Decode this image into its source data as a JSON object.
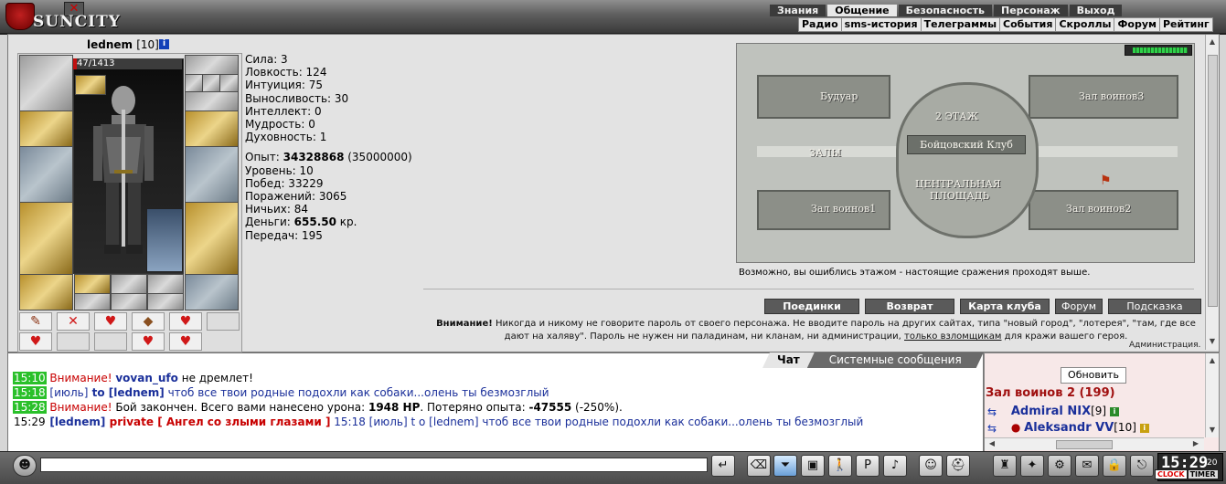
{
  "header": {
    "logo_text": "SUNCITY",
    "main_menu": [
      "Знания",
      "Общение",
      "Безопасность",
      "Персонаж",
      "Выход"
    ],
    "main_menu_active": "Общение",
    "sub_menu": [
      "Радио",
      "sms-история",
      "Телеграммы",
      "События",
      "Скроллы",
      "Форум",
      "Рейтинг"
    ]
  },
  "character": {
    "name": "lednem",
    "level_text": "[10]",
    "hp_text": "47/1413",
    "hp_fraction": 0.033
  },
  "stats": {
    "strength": "Сила: 3",
    "agility": "Ловкость: 124",
    "intuition": "Интуиция: 75",
    "endurance": "Выносливость: 30",
    "intellect": "Интеллект: 0",
    "wisdom": "Мудрость: 0",
    "spirituality": "Духовность: 1",
    "exp_label": "Опыт: ",
    "exp_value": "34328868",
    "exp_next": " (35000000)",
    "level": "Уровень: 10",
    "wins": "Побед: 33229",
    "losses": "Поражений: 3065",
    "draws": "Ничьих: 84",
    "money_label": "Деньги: ",
    "money_value": "655.50",
    "money_unit": " кр.",
    "transfers": "Передач: 195"
  },
  "map": {
    "zones": {
      "boudoir": "Будуар",
      "hall3": "Зал воинов3",
      "floor2": "2 ЭТАЖ",
      "club": "Бойцовский Клуб",
      "halls": "ЗАЛЫ",
      "square_line1": "ЦЕНТРАЛЬНАЯ",
      "square_line2": "ПЛОЩАДЬ",
      "hall1": "Зал воинов1",
      "hall2": "Зал воинов2"
    },
    "caption": "Возможно, вы ошиблись этажом - настоящие сражения проходят выше."
  },
  "nav_buttons": {
    "duels": "Поединки",
    "return": "Возврат",
    "club_map": "Карта клуба",
    "forum": "Форум",
    "hint": "Подсказка"
  },
  "warning": {
    "bold": "Внимание!",
    "text1": " Никогда и никому не говорите пароль от своего персонажа. Не вводите пароль на других сайтах, типа \"новый город\", \"лотерея\", \"там, где все дают на халяву\". Пароль не нужен ни паладинам, ни кланам, ни администрации, ",
    "link": "только взломщикам",
    "text2": " для кражи вашего героя.",
    "signature": "Администрация."
  },
  "chat": {
    "tabs": [
      "Чат",
      "Системные сообщения"
    ],
    "lines": [
      {
        "time": "15:10",
        "pre": "Внимание! ",
        "nick": "vovan_ufo",
        "text": " не дремлет!"
      },
      {
        "time": "15:18",
        "chan": "[июль]",
        "to": " to [lednem]",
        "text": " чтоб все твои родные подохли как собаки...олень ты безмозглый"
      },
      {
        "time": "15:28",
        "pre": "Внимание! ",
        "text_a": "Бой закончен. Всего вами нанесено урона: ",
        "dmg": "1948 HP",
        "text_b": ". Потеряно опыта: ",
        "exp": "-47555",
        "text_c": " (-250%)."
      },
      {
        "time": "15:29",
        "nick": "[lednem]",
        "priv": " private [ Ангел со злыми глазами ]",
        "text": " 15:18 [июль] t o [lednem] чтоб все твои родные подохли как собаки...олень ты безмозглый"
      }
    ]
  },
  "room": {
    "refresh_label": "Обновить",
    "title": "Зал воинов 2 (199)",
    "users": [
      {
        "name": "Admiral NIX",
        "level": "[9]"
      },
      {
        "name": "Aleksandr VV",
        "level": "[10]"
      }
    ]
  },
  "clock": {
    "time": "15:29",
    "seconds": "20",
    "tab_clock": "CLOCK",
    "tab_timer": "TIMER"
  },
  "colors": {
    "timestamp_bg": "#2ac02a",
    "nick_blue": "#1a2f9a",
    "alert_red": "#c80000"
  }
}
